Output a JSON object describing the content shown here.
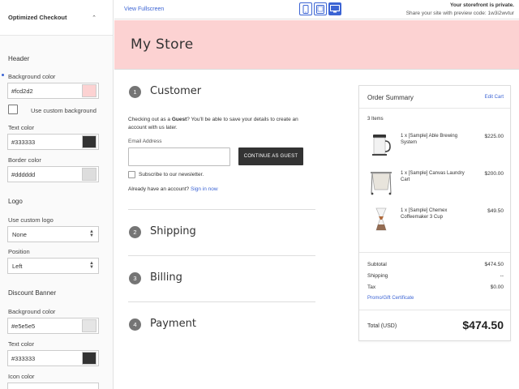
{
  "panel": {
    "title": "Optimized Checkout",
    "header_section": "Header",
    "background_color_label": "Background color",
    "background_color_value": "#fcd2d2",
    "background_swatch": "#fcd2d2",
    "use_custom_background_label": "Use custom background",
    "text_color_label": "Text color",
    "text_color_value": "#333333",
    "text_swatch": "#333333",
    "border_color_label": "Border color",
    "border_color_value": "#dddddd",
    "border_swatch": "#dddddd",
    "logo_section": "Logo",
    "use_custom_logo_label": "Use custom logo",
    "use_custom_logo_value": "None",
    "position_label": "Position",
    "position_value": "Left",
    "discount_section": "Discount Banner",
    "discount_bg_label": "Background color",
    "discount_bg_value": "#e5e5e5",
    "discount_bg_swatch": "#e5e5e5",
    "discount_text_label": "Text color",
    "discount_text_value": "#333333",
    "discount_text_swatch": "#333333",
    "icon_color_label": "Icon color"
  },
  "topbar": {
    "view_fullscreen": "View Fullscreen",
    "private_notice": "Your storefront is private.",
    "share_notice": "Share your site with preview code: 1w3i2wvtur",
    "accent": "#3c64d4"
  },
  "store": {
    "name": "My Store"
  },
  "steps": [
    {
      "number": "1",
      "title": "Customer"
    },
    {
      "number": "2",
      "title": "Shipping"
    },
    {
      "number": "3",
      "title": "Billing"
    },
    {
      "number": "4",
      "title": "Payment"
    }
  ],
  "customer": {
    "intro_pre": "Checking out as a ",
    "intro_bold": "Guest",
    "intro_post": "? You'll be able to save your details to create an account with us later.",
    "email_label": "Email Address",
    "continue_button": "CONTINUE AS GUEST",
    "newsletter_label": "Subscribe to our newsletter.",
    "have_account": "Already have an account?",
    "sign_in": "Sign in now"
  },
  "summary": {
    "title": "Order Summary",
    "edit_cart": "Edit Cart",
    "item_count": "3 Items",
    "items": [
      {
        "name": "1 x [Sample] Able Brewing System",
        "price": "$225.00"
      },
      {
        "name": "1 x [Sample] Canvas Laundry Cart",
        "price": "$200.00"
      },
      {
        "name": "1 x [Sample] Chemex Coffeemaker 3 Cup",
        "price": "$49.50"
      }
    ],
    "subtotal_label": "Subtotal",
    "subtotal_value": "$474.50",
    "shipping_label": "Shipping",
    "shipping_value": "--",
    "tax_label": "Tax",
    "tax_value": "$0.00",
    "promo_link": "Promo/Gift Certificate",
    "total_label": "Total (USD)",
    "total_value": "$474.50"
  }
}
